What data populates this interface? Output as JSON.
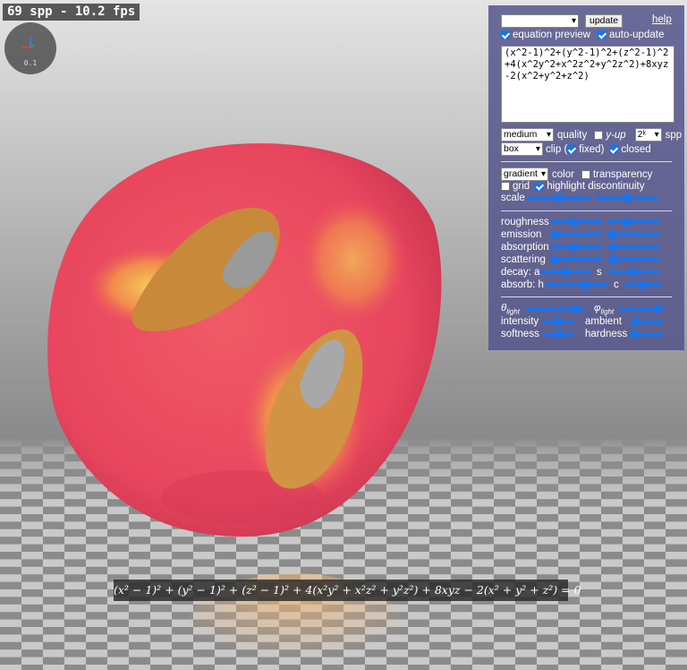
{
  "status": {
    "fps_text": "69 spp - 10.2 fps"
  },
  "gizmo": {
    "scale_label": "0.1"
  },
  "panel": {
    "preset_value": "",
    "update_label": "update",
    "help_label": "help",
    "equation_preview_label": "equation preview",
    "equation_preview_checked": true,
    "auto_update_label": "auto-update",
    "auto_update_checked": true,
    "equation_text": "(x^2-1)^2+(y^2-1)^2+(z^2-1)^2+4(x^2y^2+x^2z^2+y^2z^2)+8xyz-2(x^2+y^2+z^2)",
    "quality_value": "medium",
    "quality_label": "quality",
    "y_up_label": "y-up",
    "y_up_checked": false,
    "spp_value": "2ᵏ",
    "spp_label": "spp",
    "clip_value": "box",
    "clip_label": "clip (",
    "fixed_label": "fixed)",
    "fixed_checked": true,
    "closed_label": "closed",
    "closed_checked": true,
    "color_value": "gradient",
    "color_label": "color",
    "transparency_label": "transparency",
    "transparency_checked": false,
    "grid_label": "grid",
    "grid_checked": false,
    "highlight_label": "highlight discontinuity",
    "highlight_checked": true,
    "scale_label": "scale",
    "roughness_label": "roughness",
    "emission_label": "emission",
    "absorption_label": "absorption",
    "scattering_label": "scattering",
    "decay_label": "decay: a",
    "decay_s_label": "s",
    "absorb_label": "absorb: h",
    "absorb_c_label": "c",
    "theta_symbol": "θ",
    "phi_symbol": "φ",
    "light_sub": "light",
    "intensity_label": "intensity",
    "ambient_label": "ambient",
    "softness_label": "softness",
    "hardness_label": "hardness",
    "slider_values": {
      "scale_1": 0.5,
      "scale_2": 0.5,
      "roughness_1": 0.45,
      "roughness_2": 0.35,
      "emission_1": 0.0,
      "emission_2": 0.0,
      "absorption_1": 0.45,
      "absorption_2": 0.05,
      "scattering_1": 0.0,
      "scattering_2": 0.05,
      "decay_a": 0.5,
      "decay_s": 0.5,
      "absorb_h": 0.65,
      "absorb_c": 0.5,
      "theta_light": 0.9,
      "phi_light": 0.95,
      "intensity": 0.5,
      "ambient": 0.1,
      "softness": 0.55,
      "hardness": 0.0
    }
  },
  "formula": {
    "latex_text": "(x² − 1)² + (y² − 1)² + (z² − 1)² + 4(x²y² + x²z² + y²z²) + 8xyz − 2(x² + y² + z²) = 0"
  }
}
